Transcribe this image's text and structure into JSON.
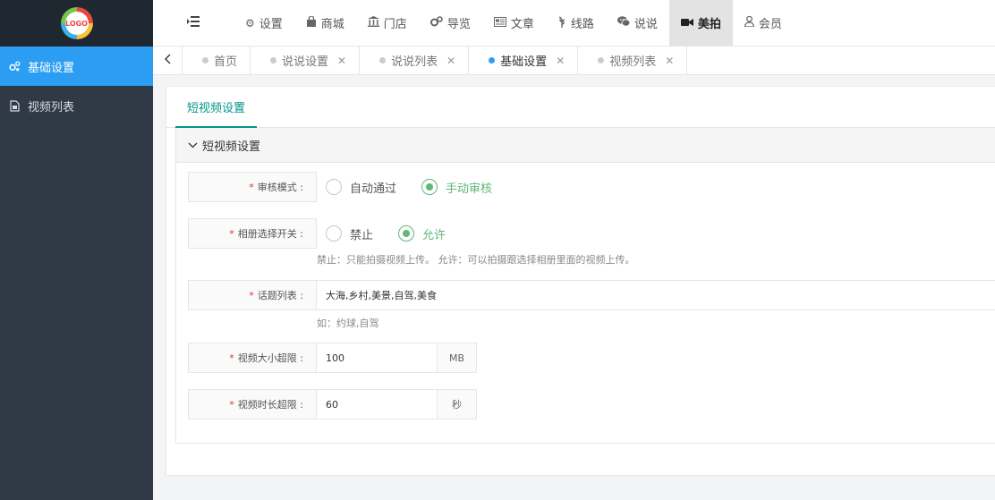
{
  "sidebar": {
    "logo_text": "LOGO",
    "items": [
      {
        "label": "基础设置",
        "icon": "gears-icon",
        "active": true
      },
      {
        "label": "视频列表",
        "icon": "file-icon",
        "active": false
      }
    ]
  },
  "topnav": {
    "menu_icon": "list-indent-icon",
    "items": [
      {
        "label": "设置",
        "icon": "gear-icon",
        "active": false
      },
      {
        "label": "商城",
        "icon": "shopping-bag-icon",
        "active": false
      },
      {
        "label": "门店",
        "icon": "bank-icon",
        "active": false
      },
      {
        "label": "导览",
        "icon": "cogs-icon",
        "active": false
      },
      {
        "label": "文章",
        "icon": "newspaper-icon",
        "active": false
      },
      {
        "label": "线路",
        "icon": "wheat-icon",
        "active": false
      },
      {
        "label": "说说",
        "icon": "wechat-icon",
        "active": false
      },
      {
        "label": "美拍",
        "icon": "video-camera-icon",
        "active": true
      },
      {
        "label": "会员",
        "icon": "user-icon",
        "active": false
      }
    ]
  },
  "tabs": [
    {
      "label": "首页",
      "closable": false,
      "active": false
    },
    {
      "label": "说说设置",
      "closable": true,
      "active": false
    },
    {
      "label": "说说列表",
      "closable": true,
      "active": false
    },
    {
      "label": "基础设置",
      "closable": true,
      "active": true
    },
    {
      "label": "视频列表",
      "closable": true,
      "active": false
    }
  ],
  "panel": {
    "subtab": "短视频设置",
    "collapse_title": "短视频设置",
    "form": {
      "audit_mode": {
        "label": "审核模式 :",
        "options": [
          {
            "label": "自动通过",
            "checked": false
          },
          {
            "label": "手动审核",
            "checked": true
          }
        ]
      },
      "album_switch": {
        "label": "相册选择开关 :",
        "options": [
          {
            "label": "禁止",
            "checked": false
          },
          {
            "label": "允许",
            "checked": true
          }
        ],
        "hint": "禁止：只能拍摄视频上传。 允许：可以拍摄跟选择相册里面的视频上传。"
      },
      "topics": {
        "label": "话题列表 :",
        "value": "大海,乡村,美景,自驾,美食",
        "hint": "如：约球,自驾"
      },
      "size_limit": {
        "label": "视频大小超限 :",
        "value": "100",
        "unit": "MB"
      },
      "duration_limit": {
        "label": "视频时长超限 :",
        "value": "60",
        "unit": "秒"
      }
    }
  },
  "colors": {
    "sidebar_bg": "#2f3a46",
    "sidebar_active": "#2b9ef3",
    "accent_green": "#5fb878",
    "subtab_green": "#009688",
    "required_red": "#e0312b"
  }
}
